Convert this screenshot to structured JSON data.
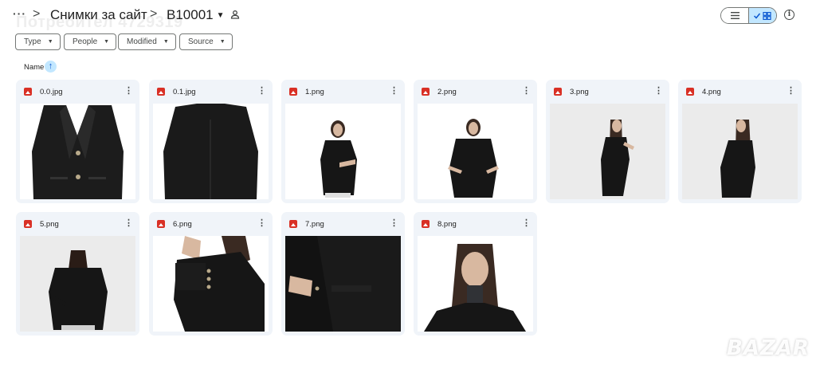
{
  "header": {
    "more": "···",
    "separator": ">",
    "breadcrumb": [
      {
        "label": "Снимки за сайт",
        "dropdown": false
      },
      {
        "label": "B10001",
        "dropdown": true
      }
    ],
    "watermark": "Потребител 4729319",
    "shared_icon": "shared-folder-icon",
    "view_toggle": {
      "options": [
        "list",
        "grid"
      ],
      "selected": "grid"
    },
    "info_icon": "info-icon",
    "info_glyph": "i"
  },
  "filters": [
    {
      "label": "Type"
    },
    {
      "label": "People"
    },
    {
      "label": "Modified"
    },
    {
      "label": "Source"
    }
  ],
  "sort": {
    "label": "Name",
    "direction": "ascending",
    "arrow": "↑"
  },
  "files": [
    {
      "name": "0.0.jpg",
      "subject": "blazer-front"
    },
    {
      "name": "0.1.jpg",
      "subject": "blazer-back"
    },
    {
      "name": "1.png",
      "subject": "model-front"
    },
    {
      "name": "2.png",
      "subject": "model-front-hands"
    },
    {
      "name": "3.png",
      "subject": "model-side"
    },
    {
      "name": "4.png",
      "subject": "model-side-walk"
    },
    {
      "name": "5.png",
      "subject": "model-back"
    },
    {
      "name": "6.png",
      "subject": "sleeve-detail"
    },
    {
      "name": "7.png",
      "subject": "pocket-detail"
    },
    {
      "name": "8.png",
      "subject": "portrait"
    }
  ],
  "colors": {
    "accent": "#0b57d0",
    "selected_bg": "#c2e7ff",
    "card_bg": "#f0f4f9",
    "image_icon": "#d93025"
  },
  "logo": "BAZAR"
}
